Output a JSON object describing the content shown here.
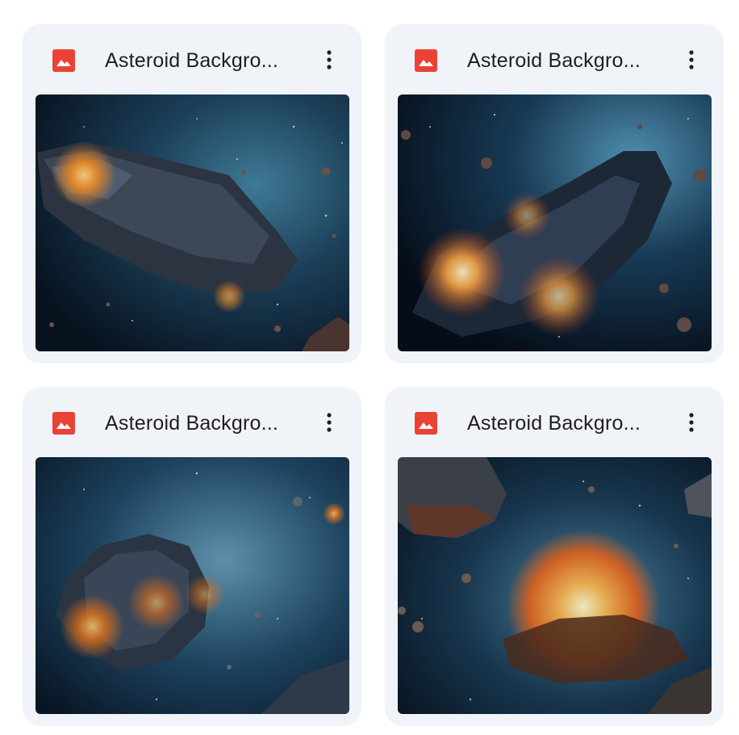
{
  "files": [
    {
      "title": "Asteroid Backgro...",
      "file_type_icon": "image-file-icon",
      "menu_icon": "more-vert-icon"
    },
    {
      "title": "Asteroid Backgro...",
      "file_type_icon": "image-file-icon",
      "menu_icon": "more-vert-icon"
    },
    {
      "title": "Asteroid Backgro...",
      "file_type_icon": "image-file-icon",
      "menu_icon": "more-vert-icon"
    },
    {
      "title": "Asteroid Backgro...",
      "file_type_icon": "image-file-icon",
      "menu_icon": "more-vert-icon"
    }
  ],
  "colors": {
    "card_bg": "#f0f3f8",
    "image_icon_red": "#ea4335",
    "title_text": "#1f1f1f",
    "menu_icon": "#1f1f1f",
    "space_dark": "#0a1a2e",
    "space_teal": "#2c5d7a",
    "fire_orange": "#f08a24"
  }
}
